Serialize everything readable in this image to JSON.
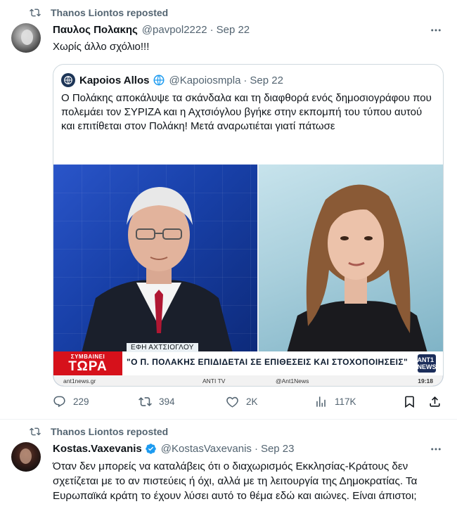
{
  "tweet1": {
    "repost_label": "Thanos Liontos reposted",
    "author_name": "Παυλος Πολακης",
    "author_handle": "@pavpol2222",
    "date": "Sep 22",
    "text": "Χωρίς άλλο  σχόλιο!!!",
    "quote": {
      "author_name": "Kapoios Allos",
      "author_handle": "@Kapoiosmpla",
      "date": "Sep 22",
      "text": "Ο Πολάκης αποκάλυψε τα σκάνδαλα και τη διαφθορά ενός δημοσιογράφου που πολεμάει τον ΣΥΡΙΖΑ και η Αχτσιόγλου βγήκε στην εκπομπή του τύπου αυτού και επιτίθεται στον Πολάκη! Μετά αναρωτιέται γιατί πάτωσε",
      "media": {
        "tag_small": "ΣΥΜΒΑΙΝΕΙ",
        "tag_big": "ΤΩΡΑ",
        "speaker": "ΕΦΗ ΑΧΤΣΙΟΓΛΟΥ",
        "headline": "\"Ο Π. ΠΟΛΑΚΗΣ ΕΠΙΔΙΔΕΤΑΙ ΣΕ ΕΠΙΘΕΣΕΙΣ ΚΑΙ ΣΤΟΧΟΠΟΙΗΣΕΙΣ\"",
        "logo": "ANT1 NEWS",
        "site": "ant1news.gr",
        "tv": "ANTI TV",
        "instagram": "@Ant1News",
        "time": "19:18"
      }
    },
    "stats": {
      "replies": "229",
      "reposts": "394",
      "likes": "2K",
      "views": "117K"
    }
  },
  "tweet2": {
    "repost_label": "Thanos Liontos reposted",
    "author_name": "Kostas.Vaxevanis",
    "author_handle": "@KostasVaxevanis",
    "date": "Sep 23",
    "text": "Όταν δεν μπορείς να καταλάβεις ότι ο διαχωρισμός Εκκλησίας-Κράτους δεν σχετίζεται  με το αν πιστεύεις ή όχι, αλλά με τη λειτουργία της Δημοκρατίας. Τα Ευρωπαϊκά κράτη το έχουν λύσει αυτό το θέμα εδώ και αιώνες. Είναι άπιστοι;"
  },
  "colors": {
    "text": "#0f1419",
    "muted": "#536471",
    "border": "#cfd9de",
    "verified": "#1d9bf0",
    "ticker_red": "#d6111b"
  },
  "icons": [
    "repost-icon",
    "more-icon",
    "globe-icon",
    "verified-icon",
    "reply-icon",
    "like-icon",
    "views-icon",
    "bookmark-icon",
    "share-icon"
  ]
}
